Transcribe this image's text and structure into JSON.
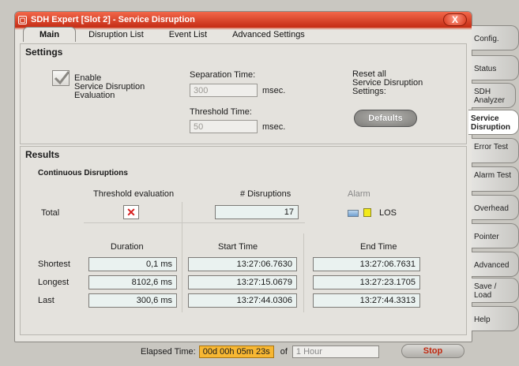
{
  "window": {
    "title": "SDH Expert  [Slot 2]  -  Service Disruption",
    "close_label": "X"
  },
  "tabs": [
    {
      "label": "Main",
      "active": true
    },
    {
      "label": "Disruption List",
      "active": false
    },
    {
      "label": "Event List",
      "active": false
    },
    {
      "label": "Advanced Settings",
      "active": false
    }
  ],
  "settings": {
    "title": "Settings",
    "enable_label": "Enable\nService Disruption\nEvaluation",
    "enabled": true,
    "separation_label": "Separation Time:",
    "separation_value": "300",
    "separation_unit": "msec.",
    "threshold_label": "Threshold Time:",
    "threshold_value": "50",
    "threshold_unit": "msec.",
    "reset_label": "Reset all\nService Disruption\nSettings:",
    "defaults_label": "Defaults"
  },
  "results": {
    "title": "Results",
    "subtitle": "Continuous Disruptions",
    "threshold_eval_header": "Threshold evaluation",
    "disruptions_header": "# Disruptions",
    "alarm_header": "Alarm",
    "total_label": "Total",
    "total_disruptions": "17",
    "alarm_los_label": "LOS",
    "columns": [
      "Duration",
      "Start Time",
      "End Time"
    ],
    "rows": [
      {
        "label": "Shortest",
        "duration": "0,1 ms",
        "start": "13:27:06.7630",
        "end": "13:27:06.7631"
      },
      {
        "label": "Longest",
        "duration": "8102,6 ms",
        "start": "13:27:15.0679",
        "end": "13:27:23.1705"
      },
      {
        "label": "Last",
        "duration": "300,6 ms",
        "start": "13:27:44.0306",
        "end": "13:27:44.3313"
      }
    ]
  },
  "statusbar": {
    "elapsed_label": "Elapsed Time:",
    "elapsed_value": "00d 00h 05m 23s",
    "of_label": "of",
    "period_placeholder": "1 Hour",
    "stop_label": "Stop"
  },
  "side_tabs": [
    {
      "label": "Config.",
      "active": false
    },
    {
      "label": "Status",
      "active": false
    },
    {
      "label": "SDH Analyzer",
      "active": false
    },
    {
      "label": "Service Disruption",
      "active": true
    },
    {
      "label": "Error Test",
      "active": false
    },
    {
      "label": "Alarm Test",
      "active": false
    },
    {
      "label": "Overhead",
      "active": false
    },
    {
      "label": "Pointer",
      "active": false
    },
    {
      "label": "Advanced",
      "active": false
    },
    {
      "label": "Save / Load",
      "active": false
    },
    {
      "label": "Help",
      "active": false
    }
  ],
  "colors": {
    "titlebar": "#d8361b",
    "elapsed_highlight": "#f7b733",
    "alarm_blue": "#6f9fd0",
    "alarm_yellow": "#f2ea1a",
    "error_red": "#d61c1c"
  }
}
